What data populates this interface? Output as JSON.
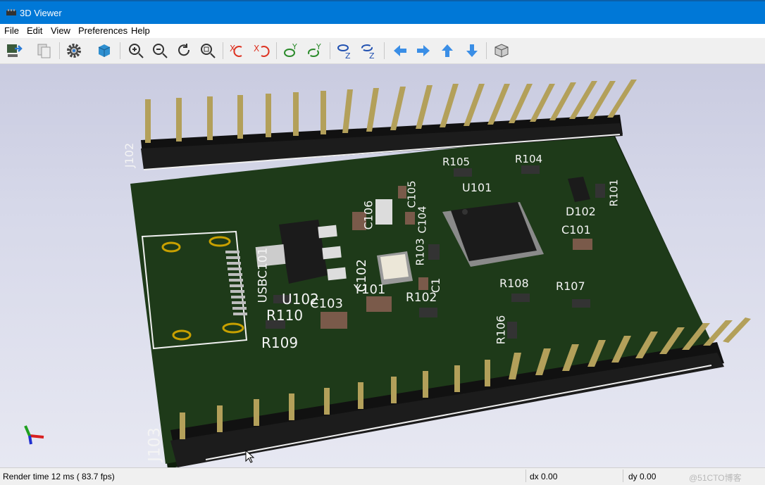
{
  "window": {
    "title": "3D Viewer",
    "app_icon": "3d-viewer-icon"
  },
  "menu": [
    "File",
    "Edit",
    "View",
    "Preferences",
    "Help"
  ],
  "toolbar": [
    {
      "name": "reload-board-icon"
    },
    {
      "name": "copy-to-clipboard-icon"
    },
    {
      "name": "settings-gear-icon"
    },
    {
      "name": "raytrace-cube-icon"
    },
    {
      "name": "zoom-in-icon"
    },
    {
      "name": "zoom-out-icon"
    },
    {
      "name": "redraw-icon"
    },
    {
      "name": "zoom-fit-icon"
    },
    {
      "name": "rotate-x-cw-icon"
    },
    {
      "name": "rotate-x-ccw-icon"
    },
    {
      "name": "rotate-y-cw-icon"
    },
    {
      "name": "rotate-y-ccw-icon"
    },
    {
      "name": "rotate-z-cw-icon"
    },
    {
      "name": "rotate-z-ccw-icon"
    },
    {
      "name": "move-left-icon"
    },
    {
      "name": "move-right-icon"
    },
    {
      "name": "move-up-icon"
    },
    {
      "name": "move-down-icon"
    },
    {
      "name": "ortho-projection-icon"
    }
  ],
  "board": {
    "silkscreen": [
      "J102",
      "J103",
      "R105",
      "R104",
      "U101",
      "R101",
      "D102",
      "C101",
      "C106",
      "C103",
      "C105",
      "C104",
      "R103",
      "C1",
      "USBC101",
      "U102",
      "C102",
      "Y101",
      "R110",
      "R102",
      "R108",
      "R107",
      "R109",
      "R106"
    ]
  },
  "status": {
    "render_time": "Render time 12 ms ( 83.7 fps)",
    "dx": "dx 0.00",
    "dy": "dy 0.00",
    "watermark": "@51CTO博客"
  },
  "colors": {
    "titlebar": "#0078d7",
    "board": "#1e3a19",
    "pin_header": "#161616",
    "pin": "#b3a05a",
    "chip": "#1b1b1b",
    "silkscreen": "#f4f4f4"
  }
}
